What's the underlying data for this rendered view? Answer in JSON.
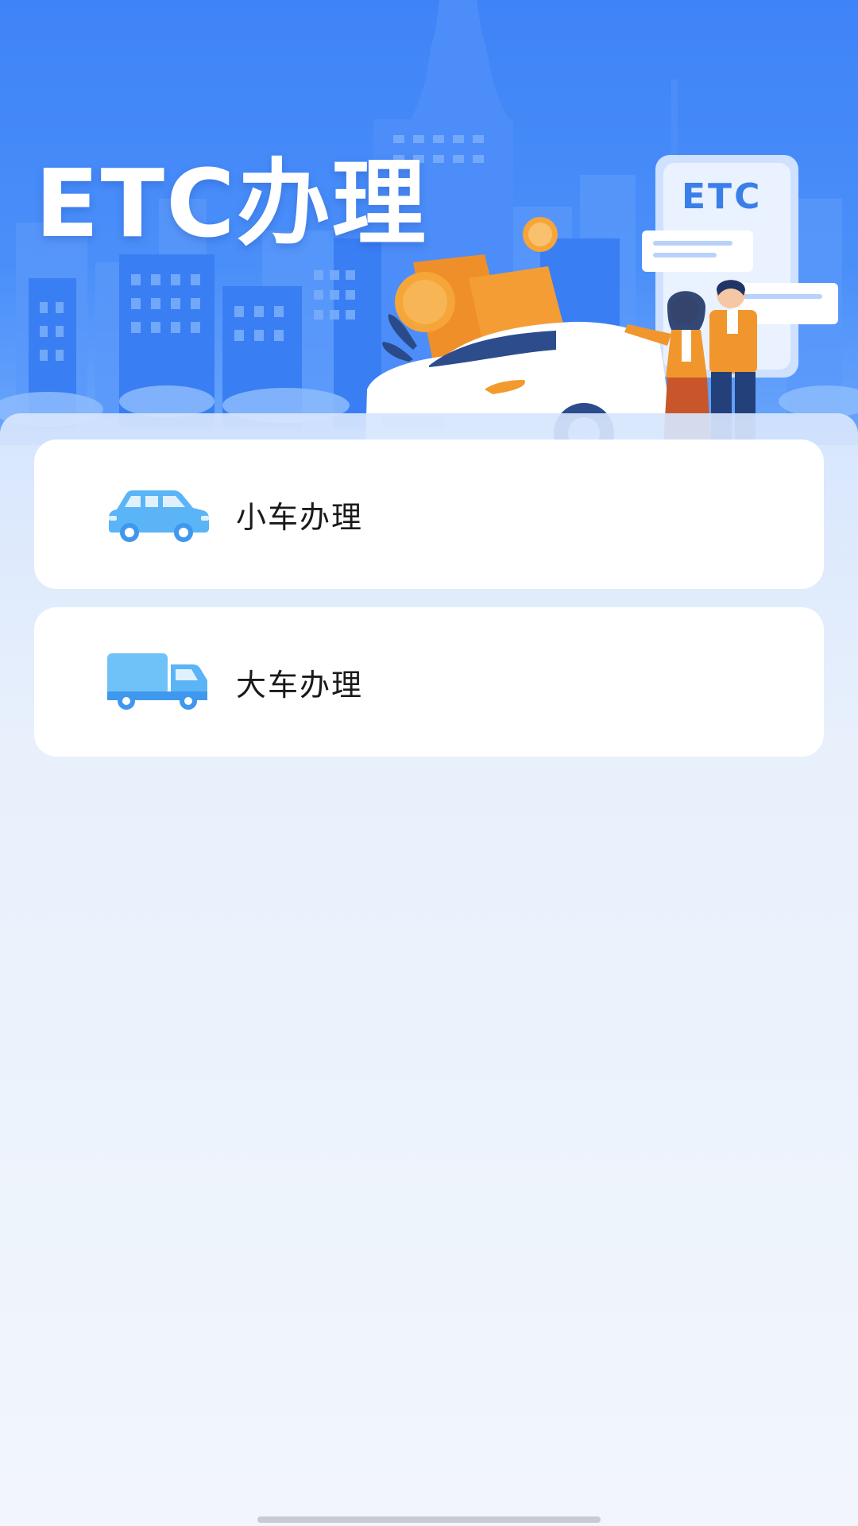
{
  "header": {
    "title": "ETC办理",
    "sign_text": "ETC"
  },
  "options": [
    {
      "label": "小车办理",
      "icon": "car-icon"
    },
    {
      "label": "大车办理",
      "icon": "truck-icon"
    }
  ],
  "colors": {
    "primary_blue": "#3f83f8",
    "accent_orange": "#f0962c",
    "icon_blue": "#5ab4f6"
  }
}
